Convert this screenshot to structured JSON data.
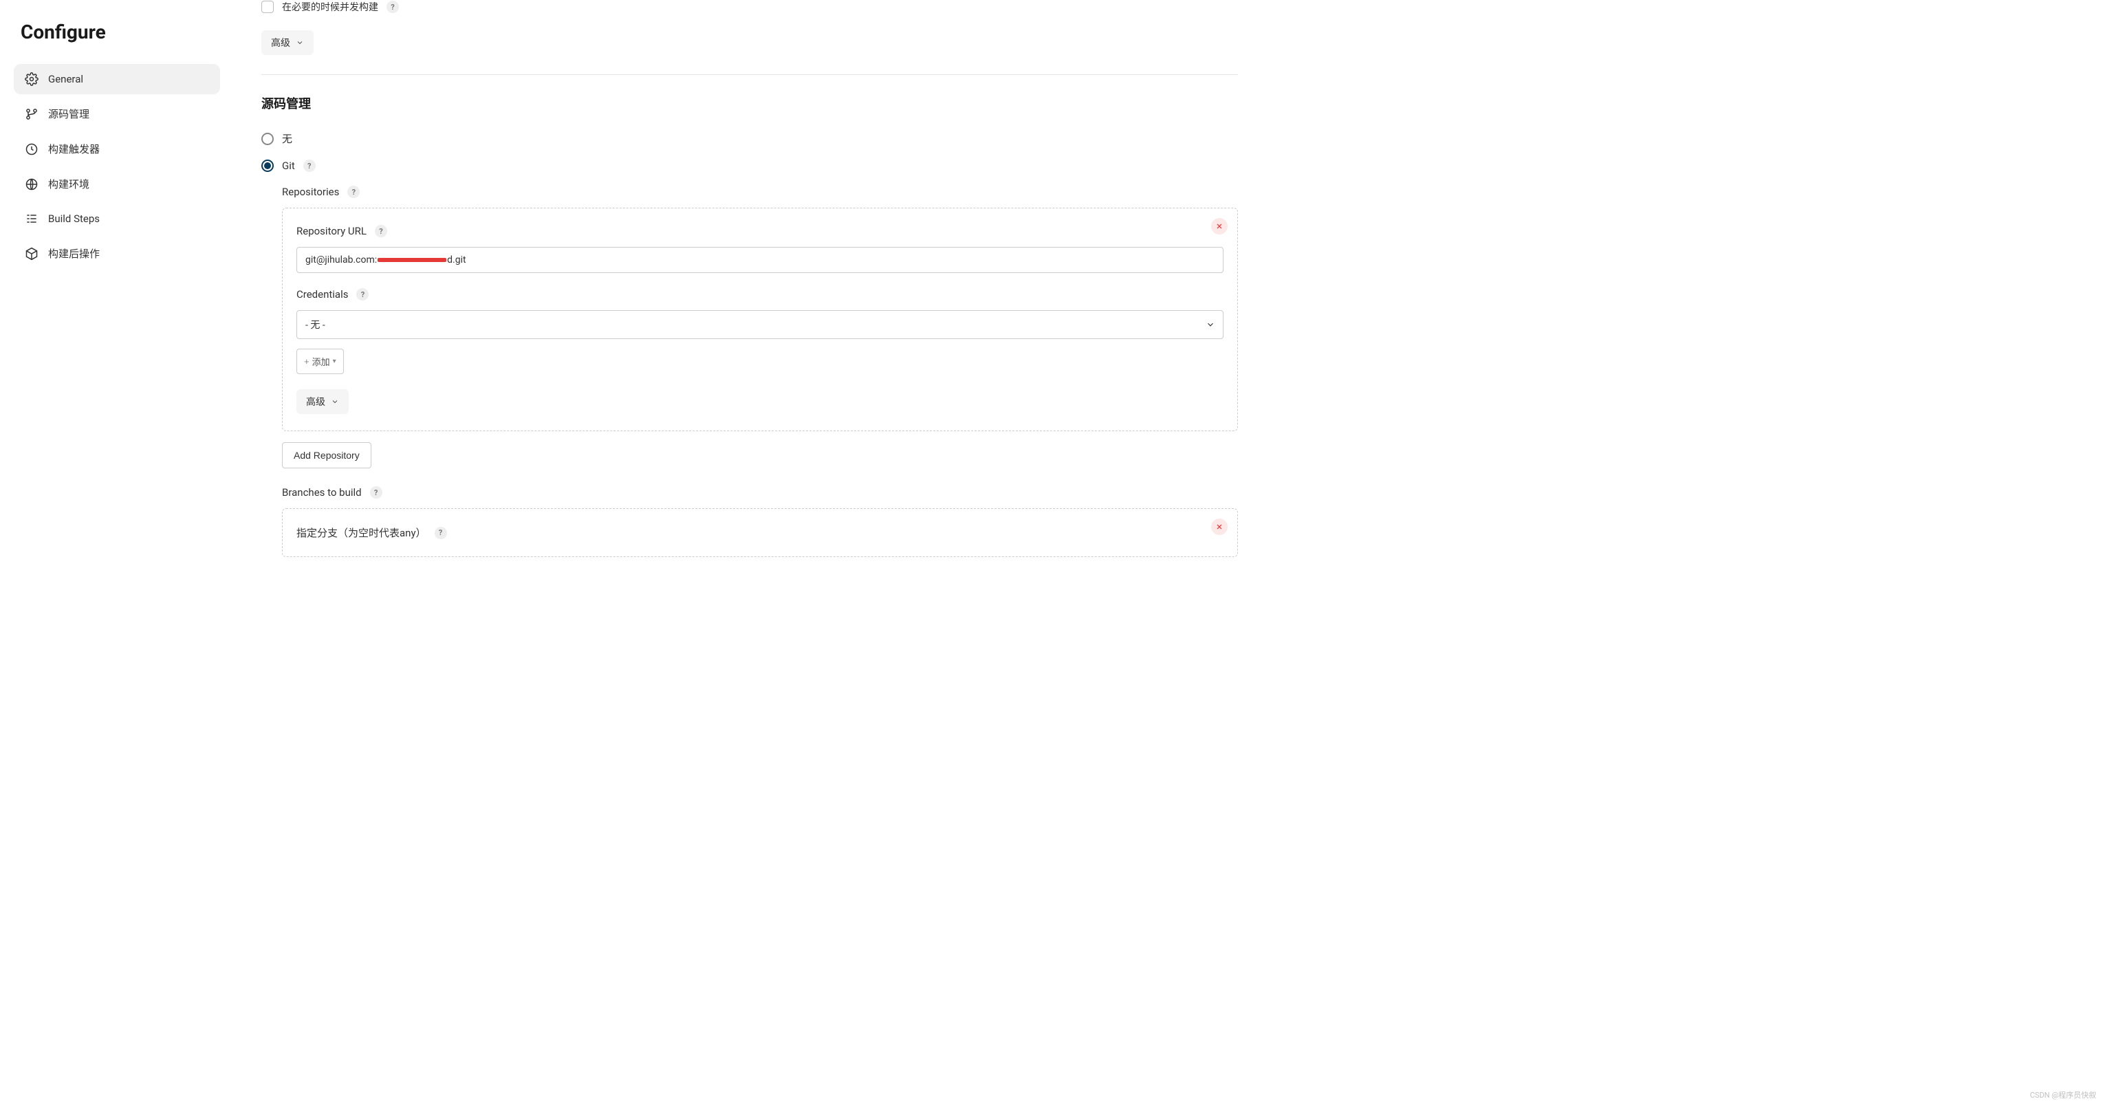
{
  "sidebar": {
    "title": "Configure",
    "items": [
      {
        "label": "General",
        "icon": "gear"
      },
      {
        "label": "源码管理",
        "icon": "branch"
      },
      {
        "label": "构建触发器",
        "icon": "clock"
      },
      {
        "label": "构建环境",
        "icon": "globe"
      },
      {
        "label": "Build Steps",
        "icon": "steps"
      },
      {
        "label": "构建后操作",
        "icon": "package"
      }
    ]
  },
  "general": {
    "concurrent_build_label": "在必要的时候并发构建",
    "advanced_label": "高级"
  },
  "scm": {
    "section_title": "源码管理",
    "none_label": "无",
    "git_label": "Git",
    "repositories_label": "Repositories",
    "repo_url_label": "Repository URL",
    "repo_url_value_prefix": "git@jihulab.com:",
    "repo_url_value_suffix": "d.git",
    "credentials_label": "Credentials",
    "credentials_value": "- 无 -",
    "add_credentials_label": "添加",
    "advanced_label": "高级",
    "add_repository_label": "Add Repository",
    "branches_label": "Branches to build",
    "branch_spec_label": "指定分支（为空时代表any）"
  },
  "watermark": "CSDN @程序员快叙"
}
